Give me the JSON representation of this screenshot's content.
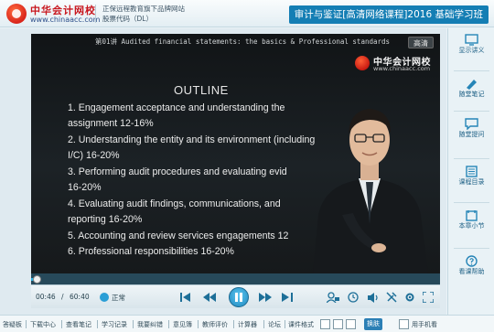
{
  "header": {
    "logo_name": "中华会计网校",
    "logo_url": "www.chinaacc.com",
    "site_line1": "正保远程教育旗下品牌网站",
    "site_line2": "股票代码（DL）",
    "course_title": "审计与鉴证[高清网络课程]2016 基础学习班"
  },
  "video": {
    "slide_title": "第01讲  Audited financial statements: the basics & Professional standards",
    "hd_label": "高清",
    "watermark_name": "中华会计网校",
    "watermark_url": "www.chinaacc.com",
    "outline_heading": "OUTLINE",
    "lines": [
      "1.     Engagement acceptance and understanding the",
      "assignment  12-16%",
      "2.     Understanding the entity and its environment (including",
      "I/C)  16-20%",
      "3.      Performing audit procedures and evaluating evid",
      "16-20%",
      "4.      Evaluating audit findings, communications, and",
      "reporting  16-20%",
      "5.      Accounting and review services engagements  12",
      "6.      Professional responsibilities       16-20%"
    ]
  },
  "player": {
    "time_current": "00:46",
    "time_separator": "/",
    "time_total": "60:40",
    "speed_label": "正常",
    "progress": 0.013
  },
  "sidebar": {
    "items": [
      {
        "label": "显示讲义",
        "icon": "lecture-icon"
      },
      {
        "label": "随堂笔记",
        "icon": "note-icon"
      },
      {
        "label": "随堂提问",
        "icon": "question-icon"
      },
      {
        "label": "课程目录",
        "icon": "catalog-icon"
      },
      {
        "label": "本章小节",
        "icon": "chapter-icon"
      },
      {
        "label": "看课帮助",
        "icon": "help-icon"
      }
    ]
  },
  "footer": {
    "items": [
      "答疑板",
      "下载中心",
      "查看笔记",
      "学习记录",
      "我要纠错",
      "意见簿",
      "教师评价",
      "计算器",
      "论坛",
      "课件格式"
    ],
    "highlight_label": "换肤",
    "mobile_label": "用手机看"
  },
  "colors": {
    "brand_red": "#c8171e",
    "title_blue": "#147eb4",
    "sidebar_text": "#1c5f84",
    "progress_blue": "#2fb5e6"
  }
}
